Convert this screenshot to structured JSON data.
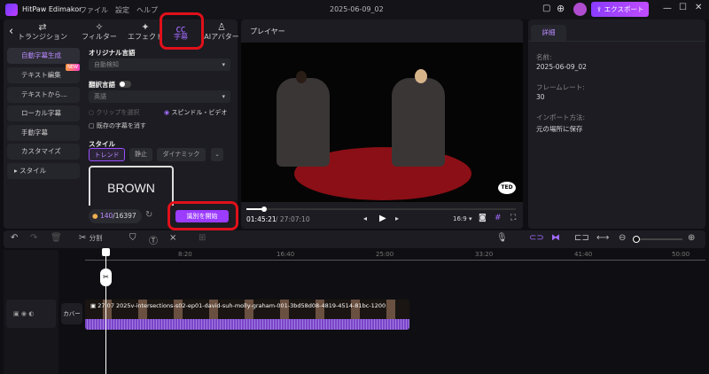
{
  "app": {
    "title": "HitPaw Edimakor",
    "menu": [
      "ファイル",
      "設定",
      "ヘルプ"
    ],
    "project": "2025-06-09_02",
    "export": "エクスポート"
  },
  "tabs": [
    {
      "label": "トランジション",
      "icon": "transition-icon"
    },
    {
      "label": "フィルター",
      "icon": "filter-icon"
    },
    {
      "label": "エフェクト",
      "icon": "effect-icon"
    },
    {
      "label": "字幕",
      "icon": "subtitle-icon"
    },
    {
      "label": "AIアバター",
      "icon": "avatar-icon"
    }
  ],
  "left_menu": [
    {
      "label": "自動字幕生成",
      "active": true
    },
    {
      "label": "テキスト編集",
      "badge": "NEW"
    },
    {
      "label": "テキストから..."
    },
    {
      "label": "ローカル字幕"
    },
    {
      "label": "手動字幕"
    },
    {
      "label": "カスタマイズ"
    },
    {
      "label": "スタイル"
    }
  ],
  "settings": {
    "original_lang_label": "オリジナル言語",
    "original_lang": "自動検知",
    "translate_label": "翻訳言語",
    "translate_lang": "英語",
    "radio_clip": "クリップを選択",
    "radio_spindle": "スピンドル・ビデオ",
    "checkbox_clear": "既存の字幕を消す",
    "style_label": "スタイル",
    "styles": [
      "トレンド",
      "静止",
      "ダイナミック"
    ],
    "preview_text": "BROWN",
    "credits_used": "140",
    "credits_total": "/16397",
    "start_button": "識別を開始"
  },
  "player": {
    "title": "プレイヤー",
    "current": "01:45:21",
    "total": "/ 27:07:10",
    "ratio": "16:9",
    "progress": 0.065,
    "badge": "TED"
  },
  "details": {
    "tab": "詳細",
    "name_label": "名前:",
    "name": "2025-06-09_02",
    "fps_label": "フレームレート:",
    "fps": "30",
    "import_label": "インポート方法:",
    "import": "元の場所に保存"
  },
  "toolbar": {
    "split": "分割"
  },
  "timeline": {
    "ticks": [
      "8:20",
      "16:40",
      "25:00",
      "33:20",
      "41:40",
      "50:00"
    ],
    "cover": "カバー",
    "clip_label": "27:07 2025v-intersections-s02-ep01-david-suh-molly-graham-001-3bd58d08-4819-4514-81bc-1200"
  },
  "colors": {
    "accent": "#9b4dff",
    "highlight": "#e0101a"
  }
}
